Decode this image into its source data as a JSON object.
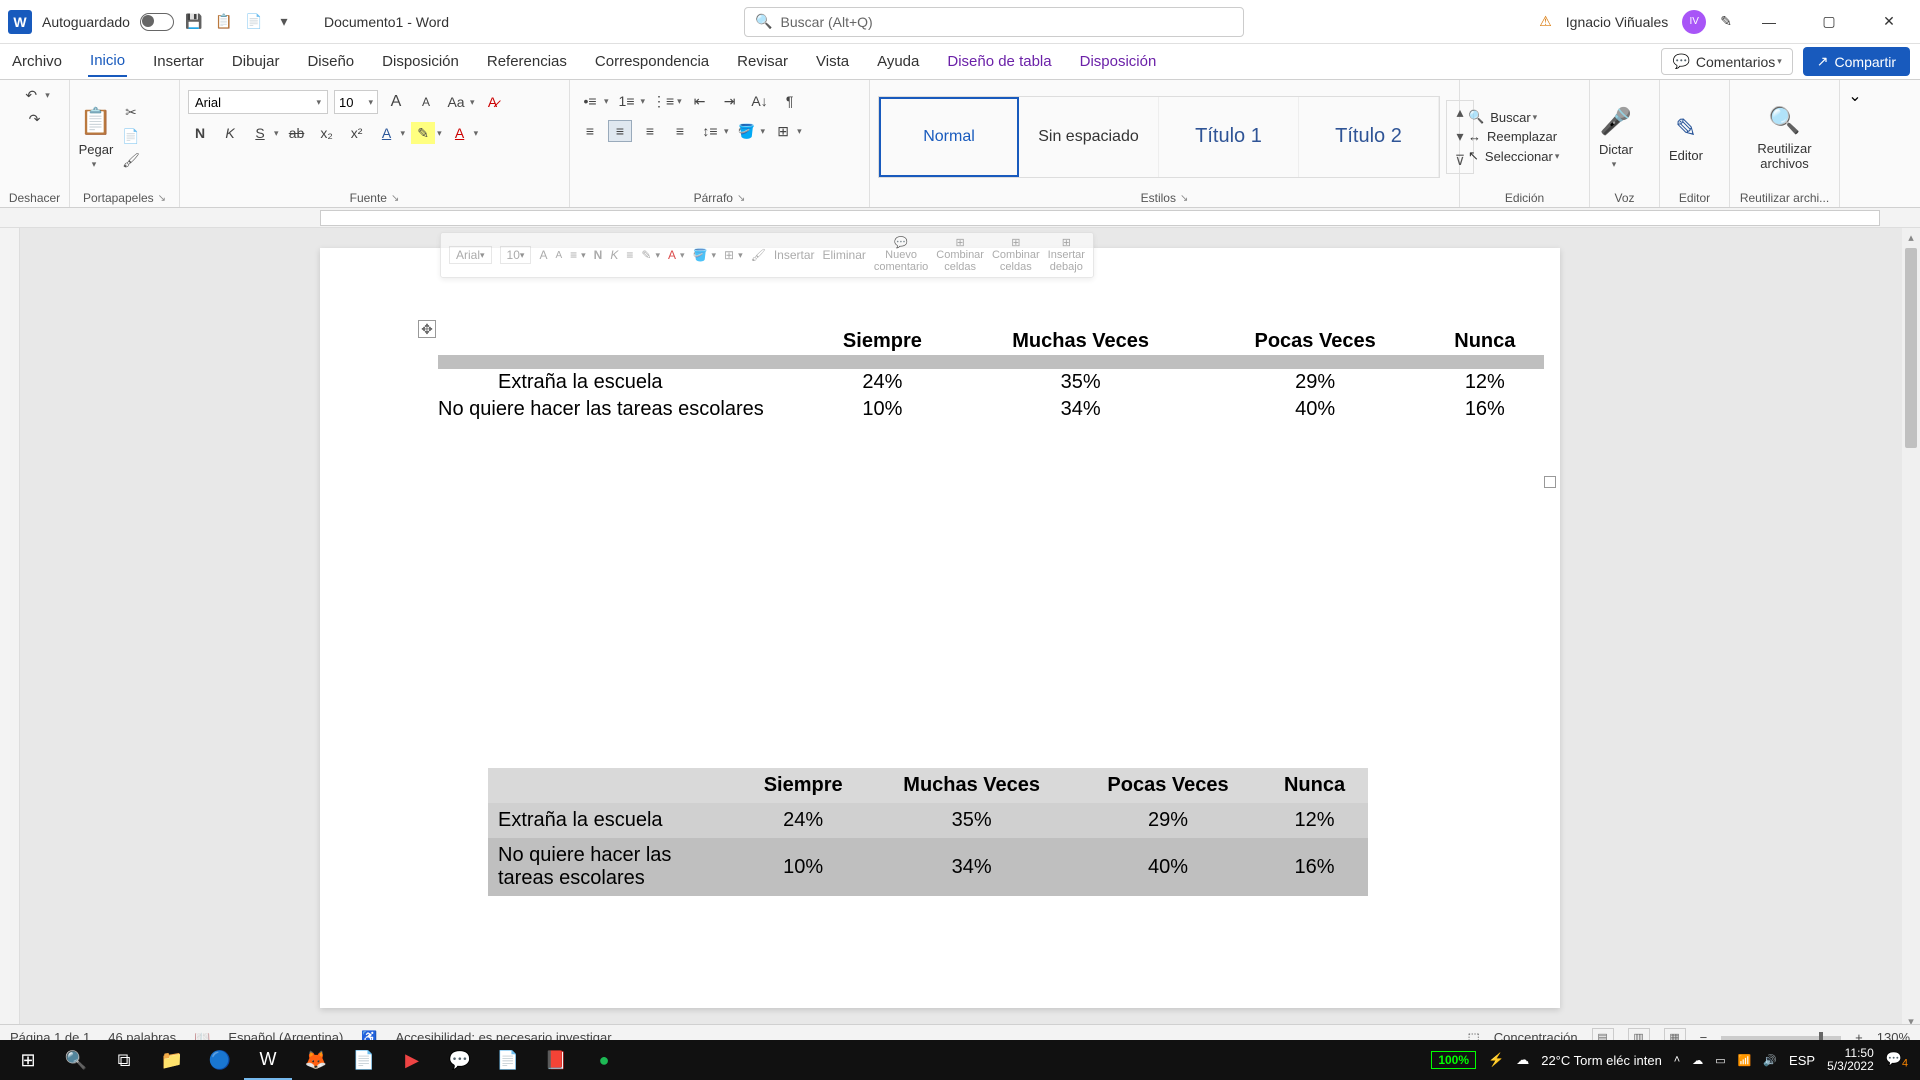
{
  "titlebar": {
    "app_letter": "W",
    "autosave_label": "Autoguardado",
    "doc_title": "Documento1 - Word",
    "search_placeholder": "Buscar (Alt+Q)",
    "username": "Ignacio Viñuales",
    "avatar_initials": "IV"
  },
  "tabs": {
    "items": [
      "Archivo",
      "Inicio",
      "Insertar",
      "Dibujar",
      "Diseño",
      "Disposición",
      "Referencias",
      "Correspondencia",
      "Revisar",
      "Vista",
      "Ayuda",
      "Diseño de tabla",
      "Disposición"
    ],
    "comments_label": "Comentarios",
    "share_label": "Compartir"
  },
  "ribbon": {
    "undo_label": "Deshacer",
    "clipboard": {
      "paste": "Pegar",
      "label": "Portapapeles"
    },
    "font": {
      "name": "Arial",
      "size": "10",
      "label": "Fuente",
      "case": "Aa",
      "inc": "A",
      "dec": "A"
    },
    "paragraph_label": "Párrafo",
    "styles": {
      "items": [
        "Normal",
        "Sin espaciado",
        "Título 1",
        "Título 2"
      ],
      "label": "Estilos"
    },
    "editing": {
      "find": "Buscar",
      "replace": "Reemplazar",
      "select": "Seleccionar",
      "label": "Edición"
    },
    "dictate": {
      "label": "Dictar",
      "group": "Voz"
    },
    "editor": {
      "label": "Editor",
      "group": "Editor"
    },
    "reuse": {
      "label": "Reutilizar archivos",
      "group": "Reutilizar archi..."
    }
  },
  "mini_toolbar": {
    "font": "Arial",
    "size": "10",
    "insert": "Insertar",
    "delete": "Eliminar",
    "comment_l1": "Nuevo",
    "comment_l2": "comentario",
    "merge1_l1": "Combinar",
    "merge1_l2": "celdas",
    "merge2_l1": "Combinar",
    "merge2_l2": "celdas",
    "below_l1": "Insertar",
    "below_l2": "debajo"
  },
  "table1": {
    "headers": [
      "",
      "Siempre",
      "Muchas Veces",
      "Pocas Veces",
      "Nunca"
    ],
    "rows": [
      {
        "label": "Extraña la escuela",
        "v": [
          "24%",
          "35%",
          "29%",
          "12%"
        ]
      },
      {
        "label": "No quiere hacer las tareas escolares",
        "v": [
          "10%",
          "34%",
          "40%",
          "16%"
        ]
      }
    ]
  },
  "table2": {
    "headers": [
      "",
      "Siempre",
      "Muchas Veces",
      "Pocas Veces",
      "Nunca"
    ],
    "rows": [
      {
        "label": "Extraña la escuela",
        "v": [
          "24%",
          "35%",
          "29%",
          "12%"
        ]
      },
      {
        "label": "No quiere hacer las tareas escolares",
        "v": [
          "10%",
          "34%",
          "40%",
          "16%"
        ]
      }
    ]
  },
  "status": {
    "page": "Página 1 de 1",
    "words": "46 palabras",
    "lang": "Español (Argentina)",
    "a11y": "Accesibilidad: es necesario investigar",
    "focus": "Concentración",
    "zoom_pct": "130%"
  },
  "taskbar": {
    "battery": "100%",
    "weather": "22°C  Torm eléc inten",
    "kbd": "ESP",
    "time": "11:50",
    "date": "5/3/2022",
    "notif_count": "4"
  }
}
